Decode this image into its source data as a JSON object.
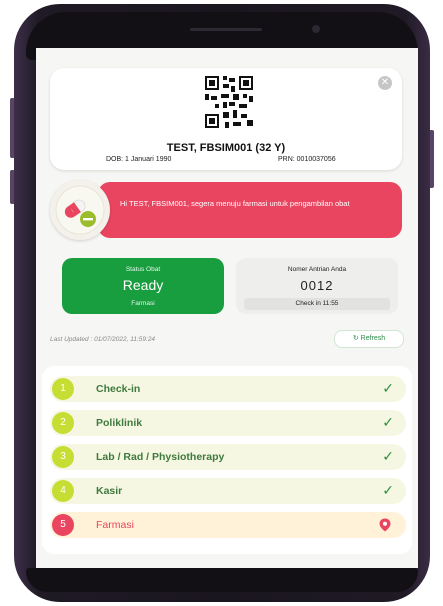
{
  "patient": {
    "name": "TEST, FBSIM001 (32 Y)",
    "dob": "DOB: 1 Januari 1990",
    "prn": "PRN: 0010037056"
  },
  "notification": {
    "message": "Hi TEST, FBSIM001, segera menuju farmasi untuk pengambilan obat",
    "icon": "pill-icon"
  },
  "status": {
    "label": "Status Obat",
    "value": "Ready",
    "location": "Farmasi"
  },
  "queue": {
    "label": "Nomer Antrian Anda",
    "number": "0012",
    "checkin": "Check in 11:55"
  },
  "last_updated": "Last Updated : 01/07/2022, 11:59:24",
  "refresh_label": "Refresh",
  "steps": [
    {
      "num": "1",
      "label": "Check-in",
      "state": "done"
    },
    {
      "num": "2",
      "label": "Poliklinik",
      "state": "done"
    },
    {
      "num": "3",
      "label": "Lab / Rad / Physiotherapy",
      "state": "done"
    },
    {
      "num": "4",
      "label": "Kasir",
      "state": "done"
    },
    {
      "num": "5",
      "label": "Farmasi",
      "state": "current"
    }
  ],
  "colors": {
    "accent_red": "#e94560",
    "status_green": "#189e3e",
    "step_done": "#c6dd34"
  }
}
